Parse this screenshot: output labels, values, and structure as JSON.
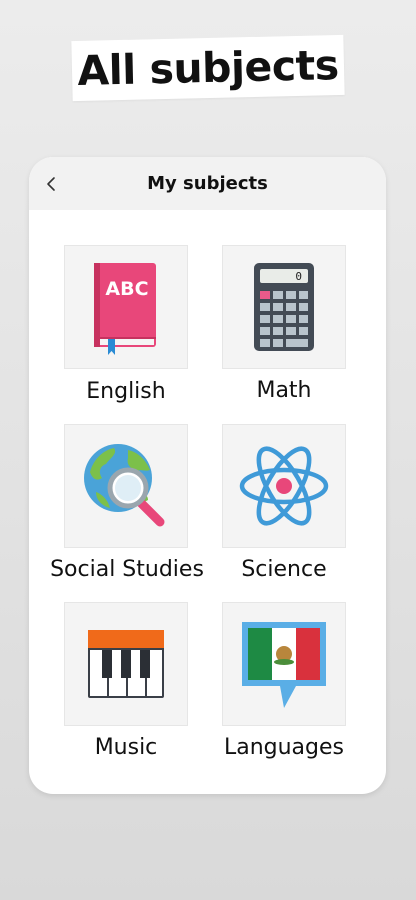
{
  "hero": {
    "title": "All subjects"
  },
  "header": {
    "title": "My subjects",
    "back_icon": "chevron-left-icon"
  },
  "subjects": [
    {
      "label": "English",
      "icon": "book-abc-icon"
    },
    {
      "label": "Math",
      "icon": "calculator-icon"
    },
    {
      "label": "Social Studies",
      "icon": "globe-magnifier-icon"
    },
    {
      "label": "Science",
      "icon": "atom-icon"
    },
    {
      "label": "Music",
      "icon": "piano-keys-icon"
    },
    {
      "label": "Languages",
      "icon": "mexico-flag-speech-bubble-icon"
    }
  ],
  "book_text": "ABC",
  "calculator_display": "0",
  "colors": {
    "card_bg": "#ffffff",
    "header_bg": "#f2f2f2",
    "tile_bg": "#f4f4f4"
  }
}
